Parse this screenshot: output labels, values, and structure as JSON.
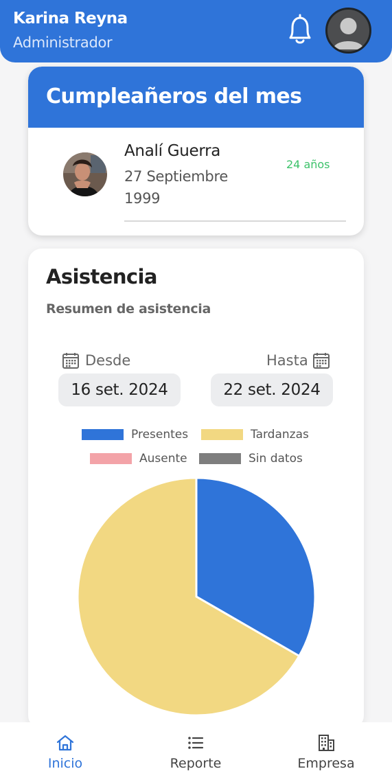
{
  "header": {
    "user_name": "Karina Reyna",
    "user_role": "Administrador",
    "bg_color": "#2f74d9",
    "icons": [
      "bell-icon",
      "avatar-icon"
    ]
  },
  "birthdays": {
    "title": "Cumpleañeros del mes",
    "items": [
      {
        "name": "Analí Guerra",
        "date": "27 Septiembre 1999",
        "age": "24 años"
      }
    ]
  },
  "attendance": {
    "title": "Asistencia",
    "subtitle": "Resumen de asistencia",
    "from_label": "Desde",
    "to_label": "Hasta",
    "from_date": "16 set. 2024",
    "to_date": "22 set. 2024"
  },
  "chart_data": {
    "type": "pie",
    "legend": [
      "Presentes",
      "Tardanzas",
      "Ausente",
      "Sin datos"
    ],
    "colors": [
      "#2f74d9",
      "#f2d882",
      "#f3a3a8",
      "#7e7e7e"
    ],
    "values": [
      1,
      2,
      0,
      0
    ],
    "legend_position": "top"
  },
  "bottom_nav": {
    "items": [
      {
        "label": "Inicio",
        "icon": "home-icon",
        "active": true
      },
      {
        "label": "Reporte",
        "icon": "list-icon",
        "active": false
      },
      {
        "label": "Empresa",
        "icon": "building-icon",
        "active": false
      }
    ]
  }
}
